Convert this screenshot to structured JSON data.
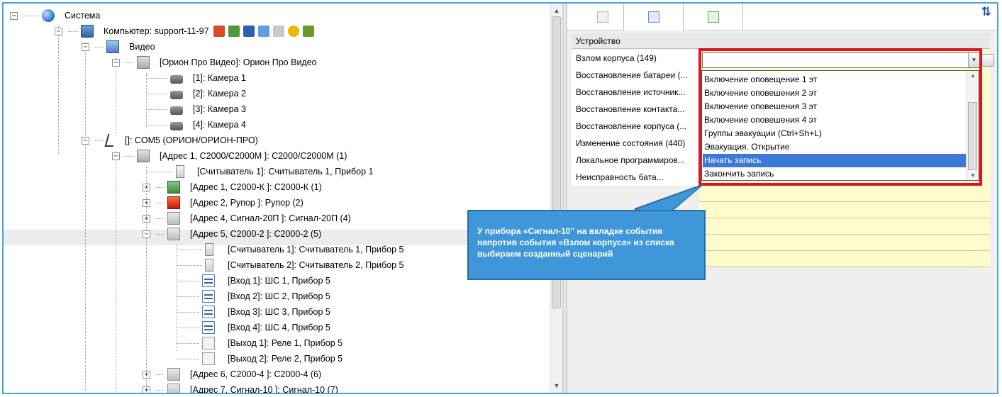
{
  "tree": {
    "items": [
      {
        "label": "Система",
        "icon": "globe-icon"
      },
      {
        "label": "Компьютер: support-11-97",
        "icon": "computer-icon"
      },
      {
        "label": "Видео",
        "icon": "video-folder-icon"
      },
      {
        "label": "[Орион Про Видео]: Орион Про Видео",
        "icon": "video-server-icon"
      },
      {
        "label": "[1]: Камера 1",
        "icon": "camera-icon"
      },
      {
        "label": "[2]: Камера 2",
        "icon": "camera-icon"
      },
      {
        "label": "[3]: Камера 3",
        "icon": "camera-icon"
      },
      {
        "label": "[4]: Камера 4",
        "icon": "camera-icon"
      },
      {
        "label": "[]: COM5 (ОРИОН/ОРИОН-ПРО)",
        "icon": "com-port-icon"
      },
      {
        "label": "[Адрес 1, С2000/С2000М ]: С2000/С2000М (1)",
        "icon": "controller-icon"
      },
      {
        "label": "[Считыватель 1]: Считыватель 1, Прибор 1",
        "icon": "reader-icon"
      },
      {
        "label": "[Адрес 1, С2000-К ]: С2000-К (1)",
        "icon": "keypad-icon"
      },
      {
        "label": "[Адрес 2, Рупор ]: Рупор (2)",
        "icon": "horn-icon"
      },
      {
        "label": "[Адрес 4, Сигнал-20П ]: Сигнал-20П (4)",
        "icon": "signal-device-icon"
      },
      {
        "label": "[Адрес 5, С2000-2 ]: С2000-2 (5)",
        "icon": "device-icon"
      },
      {
        "label": "[Считыватель 1]: Считыватель 1, Прибор 5",
        "icon": "reader-icon"
      },
      {
        "label": "[Считыватель 2]: Считыватель 2, Прибор 5",
        "icon": "reader-icon"
      },
      {
        "label": "[Вход 1]: ШС 1, Прибор 5",
        "icon": "input-icon"
      },
      {
        "label": "[Вход 2]: ШС 2, Прибор 5",
        "icon": "input-icon"
      },
      {
        "label": "[Вход 3]: ШС 3, Прибор 5",
        "icon": "input-icon"
      },
      {
        "label": "[Вход 4]: ШС 4, Прибор 5",
        "icon": "input-icon"
      },
      {
        "label": "[Выход 1]: Реле 1, Прибор 5",
        "icon": "relay-icon"
      },
      {
        "label": "[Выход 2]: Реле 2, Прибор 5",
        "icon": "relay-icon"
      },
      {
        "label": "[Адрес 6, С2000-4 ]: С2000-4 (6)",
        "icon": "device-icon"
      },
      {
        "label": "[Адрес 7, Сигнал-10 ]: Сигнал-10 (7)",
        "icon": "device-icon"
      }
    ]
  },
  "properties": {
    "group_header": "Устройство",
    "rows": [
      "Взлом корпуса (149)",
      "Восстановление батареи (...",
      "Восстановление источник...",
      "Восстановление контакта...",
      "Восстановление корпуса (...",
      "Изменение состояния (440)",
      "Локальное программиров...",
      "Неисправность бата..."
    ]
  },
  "dropdown": {
    "items": [
      "Включение оповещение 1 эт",
      "Включение оповешения 2 эт",
      "Включение оповешения 3 эт",
      "Включение оповешения 4 эт",
      "Группы эвакуации (Ctrl+Sh+L)",
      "Эвакуация. Открытие",
      "Начать запись",
      "Закончить запись"
    ],
    "selected": "Начать запись"
  },
  "callout": {
    "line1": "У прибора «Сигнал-10\" на вкладке события",
    "line2": "напротив события «Взлом корпуса» из списка",
    "line3": "выбираем созданный сценарий"
  },
  "colors": {
    "accent_border": "#4aa3df",
    "highlight_box": "#e3141b",
    "selection": "#3b78d8",
    "callout_bg": "#3f96d8",
    "value_cell": "#fffbcc"
  }
}
